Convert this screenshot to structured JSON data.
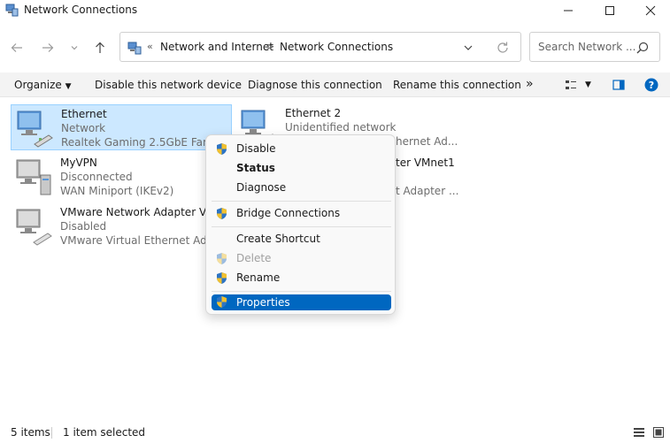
{
  "window": {
    "title": "Network Connections",
    "controls": {
      "minimize": "minimize-icon",
      "maximize": "maximize-icon",
      "close": "close-icon"
    }
  },
  "nav": {
    "back": "back-arrow-icon",
    "forward": "forward-arrow-icon",
    "recent": "chevron-down-icon",
    "up": "up-arrow-icon"
  },
  "address": {
    "overflow": "«",
    "crumbs": [
      "Network and Internet",
      "Network Connections"
    ],
    "separator": ">"
  },
  "search": {
    "placeholder": "Search Network ..."
  },
  "toolbar": {
    "organize": "Organize",
    "disable": "Disable this network device",
    "diagnose": "Diagnose this connection",
    "rename": "Rename this connection",
    "more": "»"
  },
  "items": [
    {
      "name": "Ethernet",
      "status": "Network",
      "device": "Realtek Gaming 2.5GbE Family",
      "selected": true
    },
    {
      "name": "Ethernet 2",
      "status": "Unidentified network",
      "device": "",
      "selected": false
    },
    {
      "name": "MyVPN",
      "status": "Disconnected",
      "device": "WAN Miniport (IKEv2)",
      "selected": false
    },
    {
      "name": "VMware Network Adapter VMnet1",
      "status": "Disabled",
      "device": "VMware Virtual Ethernet Adapter",
      "selected": false
    }
  ],
  "partial_text": {
    "eth2_device": "hernet Ad...",
    "vmnet_name": "ter VMnet1",
    "vmnet_device": "t Adapter ..."
  },
  "context_menu": [
    {
      "label": "Disable",
      "shield": true,
      "bold": false,
      "disabled": false,
      "highlighted": false
    },
    {
      "label": "Status",
      "shield": false,
      "bold": true,
      "disabled": false,
      "highlighted": false
    },
    {
      "label": "Diagnose",
      "shield": false,
      "bold": false,
      "disabled": false,
      "highlighted": false
    },
    {
      "label": "Bridge Connections",
      "shield": true,
      "bold": false,
      "disabled": false,
      "highlighted": false
    },
    {
      "label": "Create Shortcut",
      "shield": false,
      "bold": false,
      "disabled": false,
      "highlighted": false
    },
    {
      "label": "Delete",
      "shield": true,
      "bold": false,
      "disabled": true,
      "highlighted": false
    },
    {
      "label": "Rename",
      "shield": true,
      "bold": false,
      "disabled": false,
      "highlighted": false
    },
    {
      "label": "Properties",
      "shield": true,
      "bold": false,
      "disabled": false,
      "highlighted": true
    }
  ],
  "status": {
    "count": "5 items",
    "selected": "1 item selected"
  },
  "colors": {
    "selection": "#cce8ff",
    "selection_border": "#99d1ff",
    "menu_highlight": "#0067c0",
    "help": "#0067c0"
  }
}
